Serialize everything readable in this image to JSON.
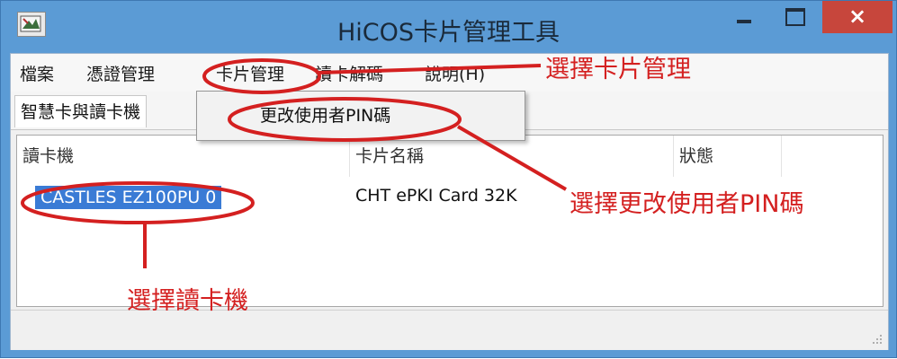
{
  "window": {
    "title": "HiCOS卡片管理工具",
    "minimize_icon": "minimize-icon",
    "maximize_icon": "maximize-icon",
    "close_glyph": "×"
  },
  "menubar": {
    "items": [
      "檔案",
      "憑證管理",
      "卡片管理",
      "讀卡解碼",
      "說明(H)"
    ]
  },
  "tab": {
    "label": "智慧卡與讀卡機"
  },
  "dropdown": {
    "item": "更改使用者PIN碼"
  },
  "list": {
    "columns": [
      "讀卡機",
      "卡片名稱",
      "狀態"
    ],
    "rows": [
      {
        "reader": "CASTLES EZ100PU 0",
        "card": "CHT ePKI Card 32K"
      }
    ]
  },
  "annotations": {
    "select_card_mgmt": "選擇卡片管理",
    "select_change_pin": "選擇更改使用者PIN碼",
    "select_reader": "選擇讀卡機"
  },
  "colors": {
    "titlebar": "#5b9bd5",
    "close_button": "#c7463c",
    "selection": "#3a7bd5",
    "annotation_red": "#d42020"
  }
}
